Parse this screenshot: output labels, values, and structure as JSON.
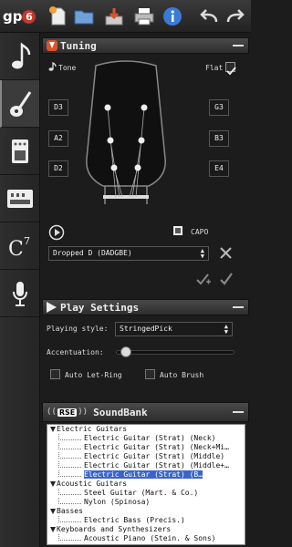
{
  "app": {
    "logo_text": "gp",
    "logo_badge": "6"
  },
  "tuning": {
    "title": "Tuning",
    "tone_label": "Tone",
    "flat_label": "Flat",
    "left_strings": [
      "D3",
      "A2",
      "D2"
    ],
    "right_strings": [
      "G3",
      "B3",
      "E4"
    ],
    "capo_label": "CAPO",
    "preset": "Dropped D (DADGBE)"
  },
  "play": {
    "title": "Play Settings",
    "style_label": "Playing style:",
    "style_value": "StringedPick",
    "accentuation_label": "Accentuation:",
    "accentuation_level": 0.03,
    "let_ring_label": "Auto Let-Ring",
    "brush_label": "Auto Brush"
  },
  "soundbank": {
    "badge_text": "RSE",
    "title": "SoundBank",
    "groups": [
      {
        "label": "Electric Guitars",
        "items": [
          "Electric Guitar (Strat) (Neck)",
          "Electric Guitar (Strat) (Neck+Mi…",
          "Electric Guitar (Strat) (Middle)",
          "Electric Guitar (Strat) (Middle+…",
          "Electric Guitar (Strat) (B…"
        ]
      },
      {
        "label": "Acoustic Guitars",
        "items": [
          "Steel Guitar (Mart. & Co.)",
          "Nylon (Spinosa)"
        ]
      },
      {
        "label": "Basses",
        "items": [
          "Electric Bass (Precis.)"
        ]
      },
      {
        "label": "Keyboards and Synthesizers",
        "items": [
          "Acoustic Piano (Stein. & Sons)"
        ]
      }
    ]
  },
  "colors": {
    "accent": "#d9542b",
    "selection": "#3a64c8"
  }
}
